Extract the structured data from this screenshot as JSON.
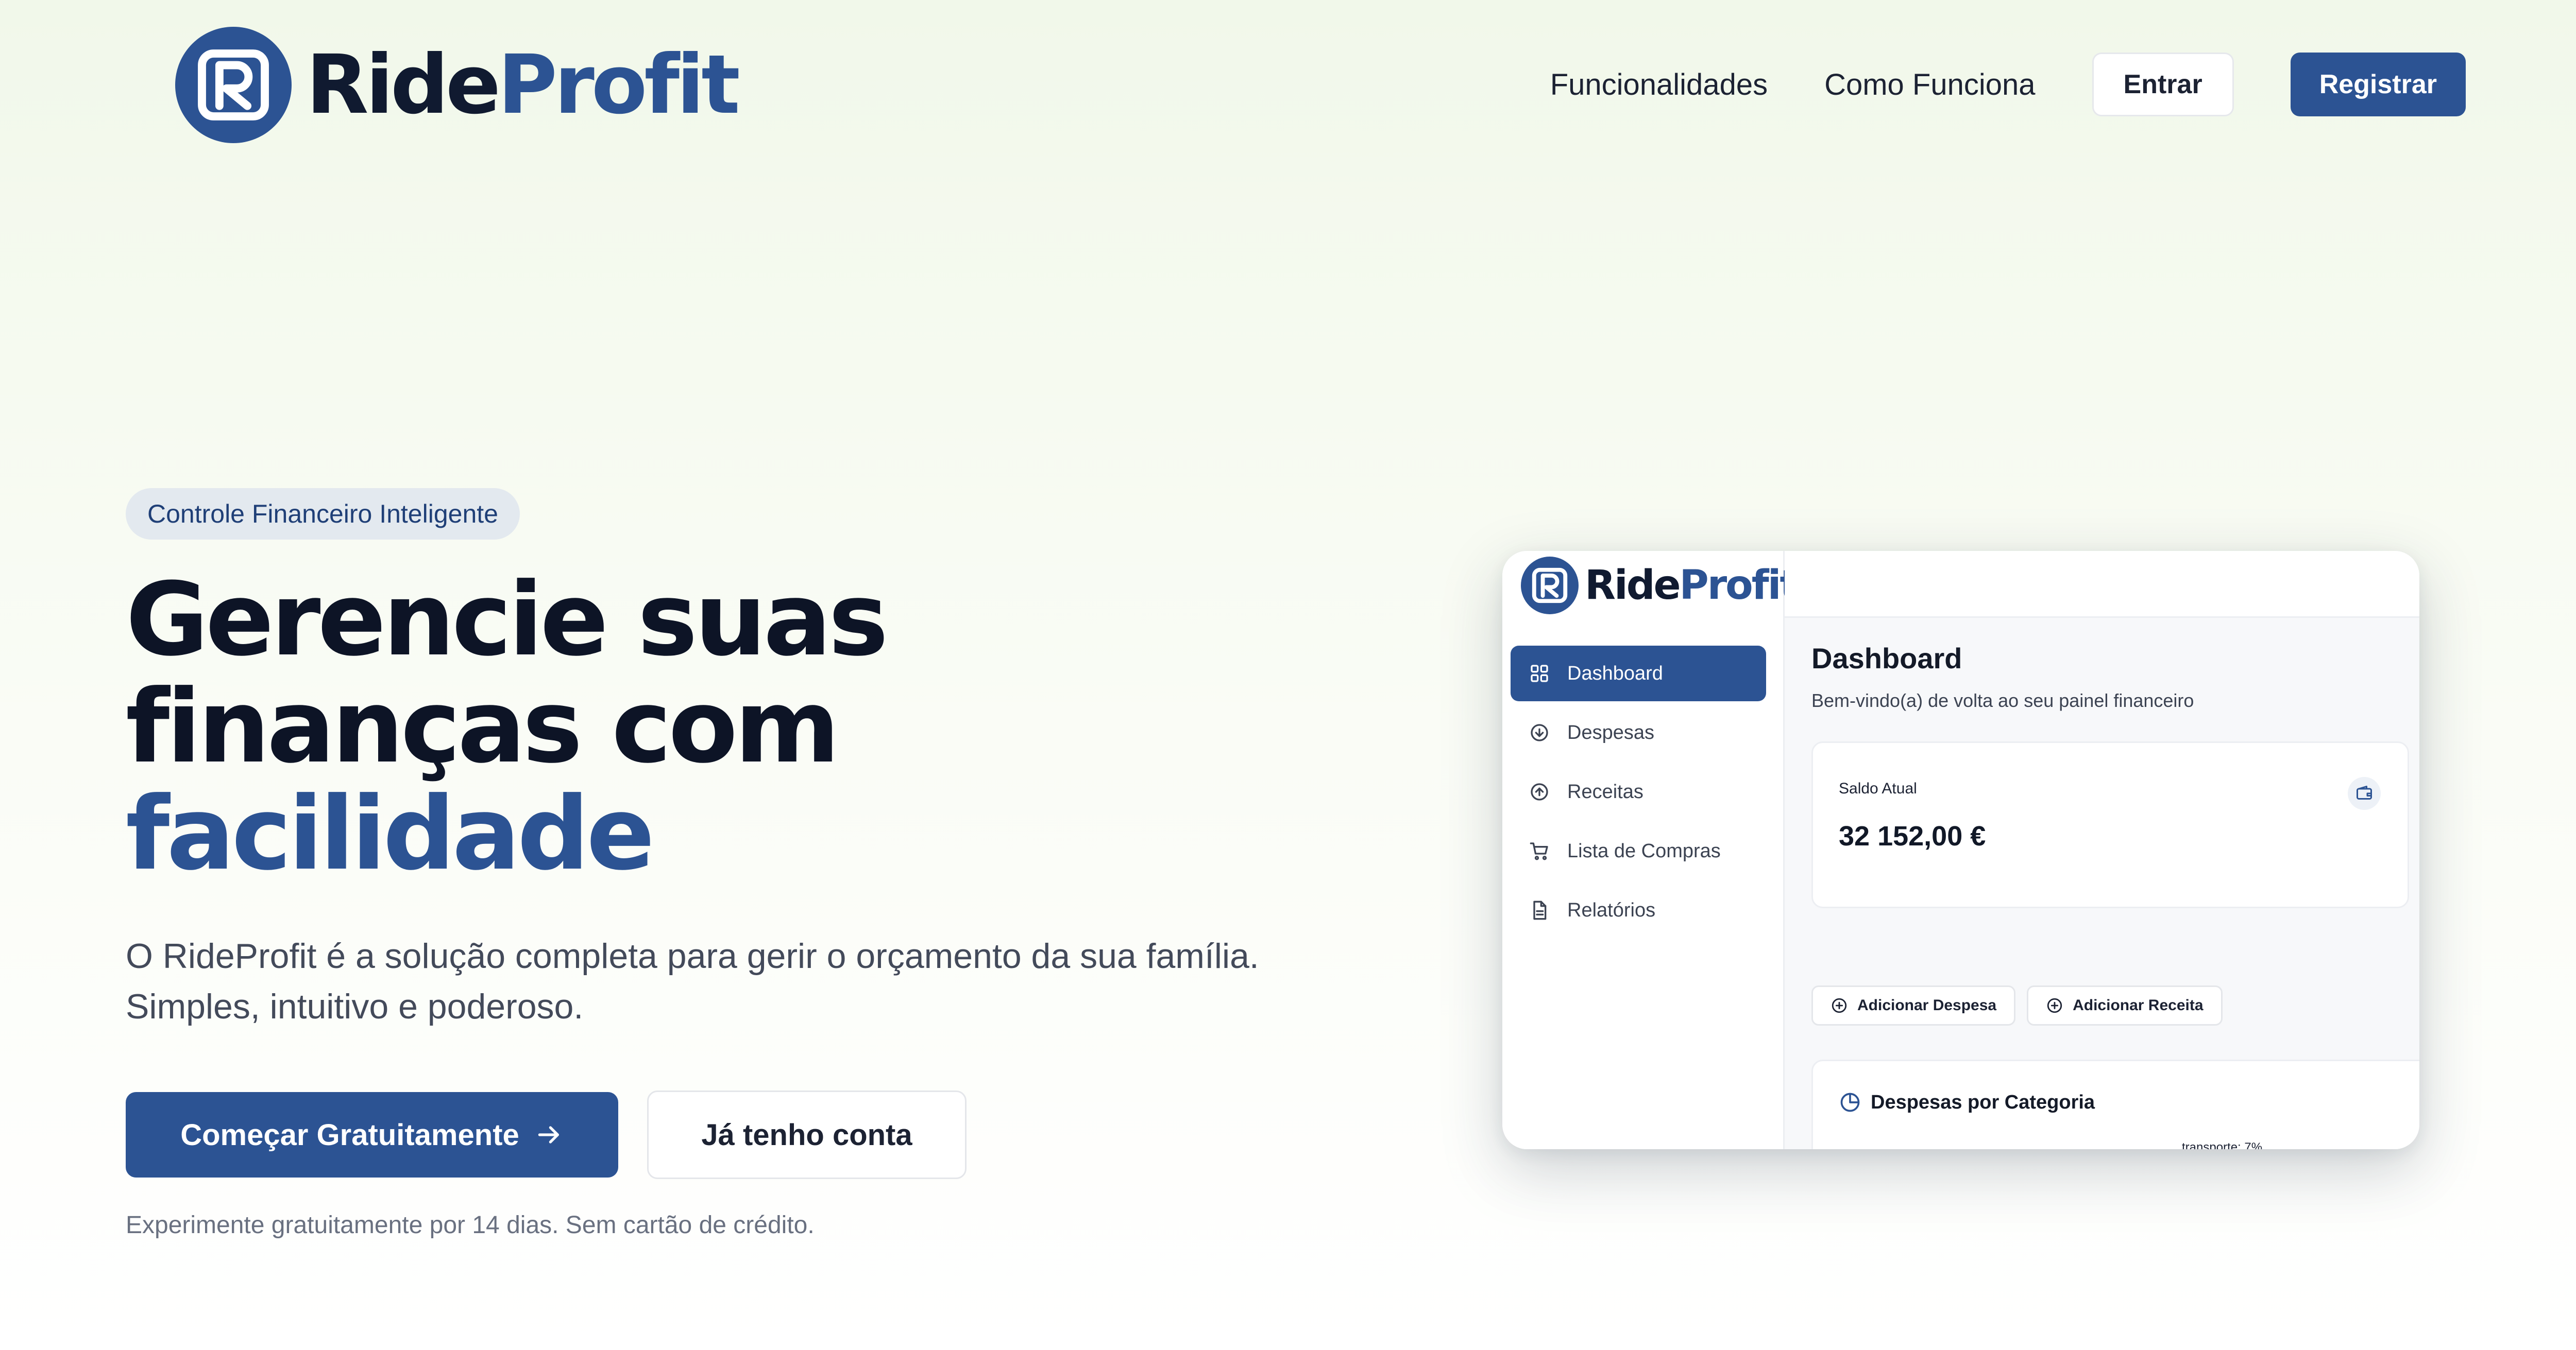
{
  "brand": {
    "ride": "Ride",
    "profit": "Profit"
  },
  "nav": {
    "links": [
      "Funcionalidades",
      "Como Funciona"
    ],
    "login_label": "Entrar",
    "register_label": "Registrar"
  },
  "hero": {
    "badge": "Controle Financeiro Inteligente",
    "headline_line1": "Gerencie suas",
    "headline_line2": "finanças com",
    "headline_accent": "facilidade",
    "subtext": "O RideProfit é a solução completa para gerir o orçamento da sua família. Simples, intuitivo e poderoso.",
    "cta_primary": "Começar Gratuitamente",
    "cta_secondary": "Já tenho conta",
    "trial_note": "Experimente gratuitamente por 14 dias. Sem cartão de crédito."
  },
  "preview": {
    "brand": {
      "ride": "Ride",
      "profit": "Profit"
    },
    "sidebar": [
      {
        "label": "Dashboard",
        "icon": "dashboard-grid-icon",
        "active": true
      },
      {
        "label": "Despesas",
        "icon": "arrow-down-circle-icon",
        "active": false
      },
      {
        "label": "Receitas",
        "icon": "arrow-up-circle-icon",
        "active": false
      },
      {
        "label": "Lista de Compras",
        "icon": "shopping-cart-icon",
        "active": false
      },
      {
        "label": "Relatórios",
        "icon": "report-file-icon",
        "active": false
      }
    ],
    "title": "Dashboard",
    "subtitle": "Bem-vindo(a) de volta ao seu painel financeiro",
    "balance_label": "Saldo Atual",
    "balance_value": "32 152,00 €",
    "actions": [
      "Adicionar Despesa",
      "Adicionar Receita"
    ],
    "chart_title": "Despesas por Categoria",
    "pie_label": "transporte: 7%"
  },
  "colors": {
    "brand_primary": "#2c5393",
    "text_dark": "#0d1426",
    "pie_purple": "#5b5be6",
    "pie_cyan": "#11a9e8"
  }
}
